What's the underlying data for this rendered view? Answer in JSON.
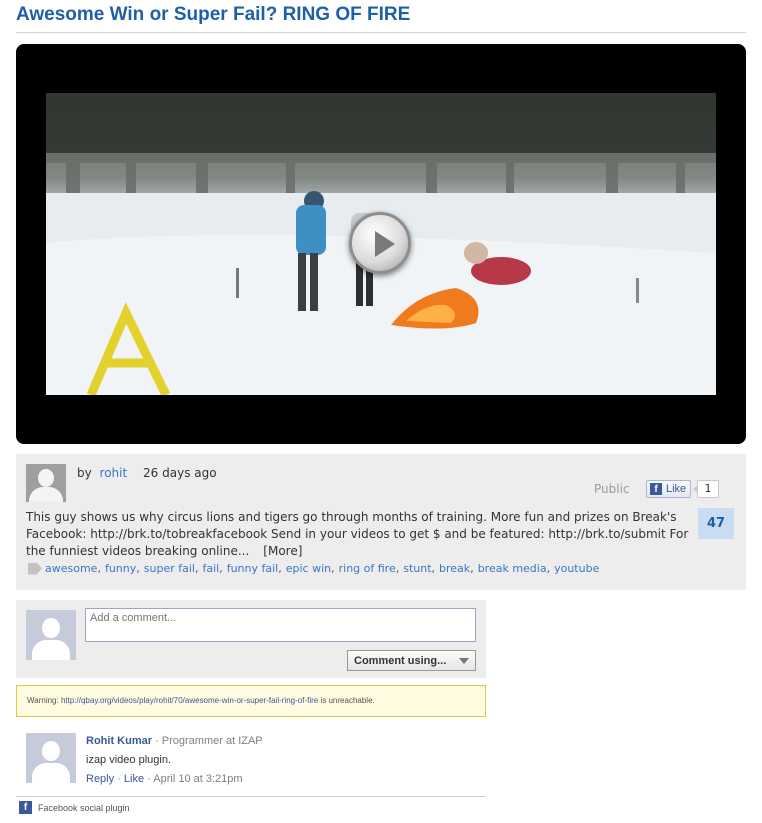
{
  "page": {
    "title": "Awesome Win or Super Fail? RING OF FIRE"
  },
  "video": {
    "play_icon": "play-icon"
  },
  "meta": {
    "by_prefix": "by",
    "author": "rohit",
    "posted": "26 days ago",
    "privacy": "Public",
    "like_label": "Like",
    "like_count": "1",
    "views": "47",
    "description": "This guy shows us why circus lions and tigers go through months of training. More fun and prizes on Break's Facebook: http://brk.to/tobreakfacebook Send in your videos to get $ and be featured: http://brk.to/submit For the funniest videos breaking online...",
    "more_label": "[More]",
    "tags": [
      "awesome",
      "funny",
      "super fail",
      "fail",
      "funny fail",
      "epic win",
      "ring of fire",
      "stunt",
      "break",
      "break media",
      "youtube"
    ]
  },
  "comments_plugin": {
    "placeholder": "Add a comment...",
    "comment_using_label": "Comment using...",
    "warning_prefix": "Warning:",
    "warning_url": "http://qbay.org/videos/play/rohit/70/awesome-win-or-super-fail-ring-of-fire",
    "warning_suffix": "is unreachable.",
    "comment": {
      "name": "Rohit Kumar",
      "tagline": "· Programmer at IZAP",
      "text": "izap video plugin.",
      "reply_label": "Reply",
      "like_label": "Like",
      "timestamp": "· April 10 at 3:21pm"
    },
    "footer": "Facebook social plugin"
  },
  "colors": {
    "title": "#1f5fa8",
    "link": "#3b77c1",
    "facebook": "#3b5998",
    "views_badge": "#c9ddf2"
  }
}
